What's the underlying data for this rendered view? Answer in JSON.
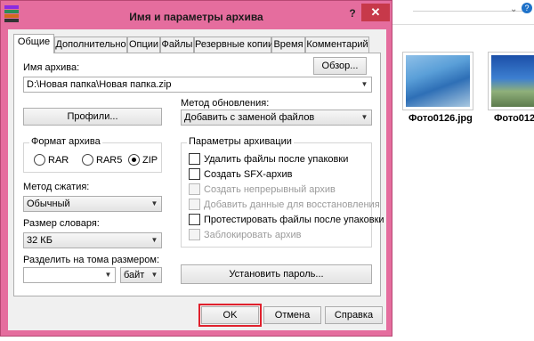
{
  "window": {
    "title": "Имя и параметры архива",
    "help": "?",
    "close": "✕"
  },
  "tabs": [
    {
      "label": "Общие",
      "active": true
    },
    {
      "label": "Дополнительно",
      "active": false
    },
    {
      "label": "Опции",
      "active": false
    },
    {
      "label": "Файлы",
      "active": false
    },
    {
      "label": "Резервные копии",
      "active": false
    },
    {
      "label": "Время",
      "active": false
    },
    {
      "label": "Комментарий",
      "active": false
    }
  ],
  "archive_name": {
    "label": "Имя архива:",
    "browse": "Обзор...",
    "value": "D:\\Новая папка\\Новая папка.zip"
  },
  "profiles": {
    "button": "Профили..."
  },
  "update_method": {
    "label": "Метод обновления:",
    "value": "Добавить с заменой файлов"
  },
  "archive_format": {
    "label": "Формат архива",
    "options": [
      {
        "label": "RAR",
        "selected": false
      },
      {
        "label": "RAR5",
        "selected": false
      },
      {
        "label": "ZIP",
        "selected": true
      }
    ]
  },
  "archive_options": {
    "label": "Параметры архивации",
    "items": [
      {
        "label": "Удалить файлы после упаковки",
        "enabled": true,
        "checked": false
      },
      {
        "label": "Создать SFX-архив",
        "enabled": true,
        "checked": false
      },
      {
        "label": "Создать непрерывный архив",
        "enabled": false,
        "checked": false
      },
      {
        "label": "Добавить данные для восстановления",
        "enabled": false,
        "checked": false
      },
      {
        "label": "Протестировать файлы после упаковки",
        "enabled": true,
        "checked": false
      },
      {
        "label": "Заблокировать архив",
        "enabled": false,
        "checked": false
      }
    ]
  },
  "compression": {
    "label": "Метод сжатия:",
    "value": "Обычный"
  },
  "dictionary": {
    "label": "Размер словаря:",
    "value": "32 КБ"
  },
  "split": {
    "label": "Разделить на тома размером:",
    "value": "",
    "unit": "байт"
  },
  "password": {
    "button": "Установить пароль..."
  },
  "footer": {
    "ok": "OK",
    "cancel": "Отмена",
    "help": "Справка"
  },
  "background": {
    "thumbnails": [
      {
        "caption": "Фото0126.jpg"
      },
      {
        "caption": "Фото012"
      }
    ]
  },
  "colors": {
    "titlebar": "#e56d9e",
    "close": "#c7394a",
    "ok_highlight": "#e0202c"
  }
}
